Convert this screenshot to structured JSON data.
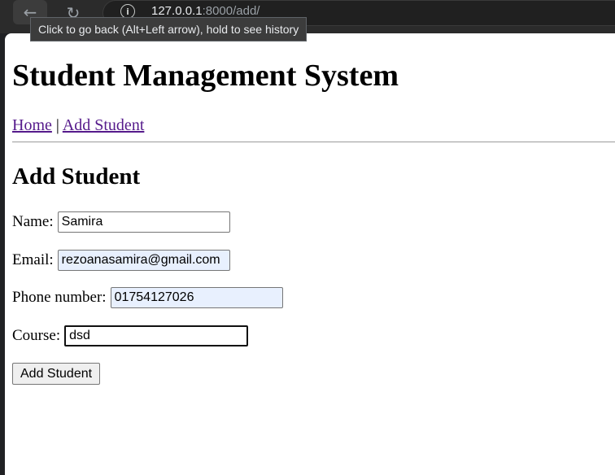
{
  "browser": {
    "back_icon": "arrow-left-icon",
    "reload_icon": "reload-icon",
    "info_icon": "info-icon",
    "url_host": "127.0.0.1",
    "url_rest": ":8000/add/",
    "tooltip": "Click to go back (Alt+Left arrow), hold to see history"
  },
  "page": {
    "title": "Student Management System",
    "nav": {
      "home": "Home",
      "separator": "|",
      "add_student": "Add Student"
    },
    "form_heading": "Add Student",
    "fields": {
      "name": {
        "label": "Name:",
        "value": "Samira"
      },
      "email": {
        "label": "Email:",
        "value": "rezoanasamira@gmail.com"
      },
      "phone": {
        "label": "Phone number:",
        "value": "01754127026"
      },
      "course": {
        "label": "Course:",
        "value": "dsd"
      }
    },
    "submit_label": "Add Student"
  }
}
